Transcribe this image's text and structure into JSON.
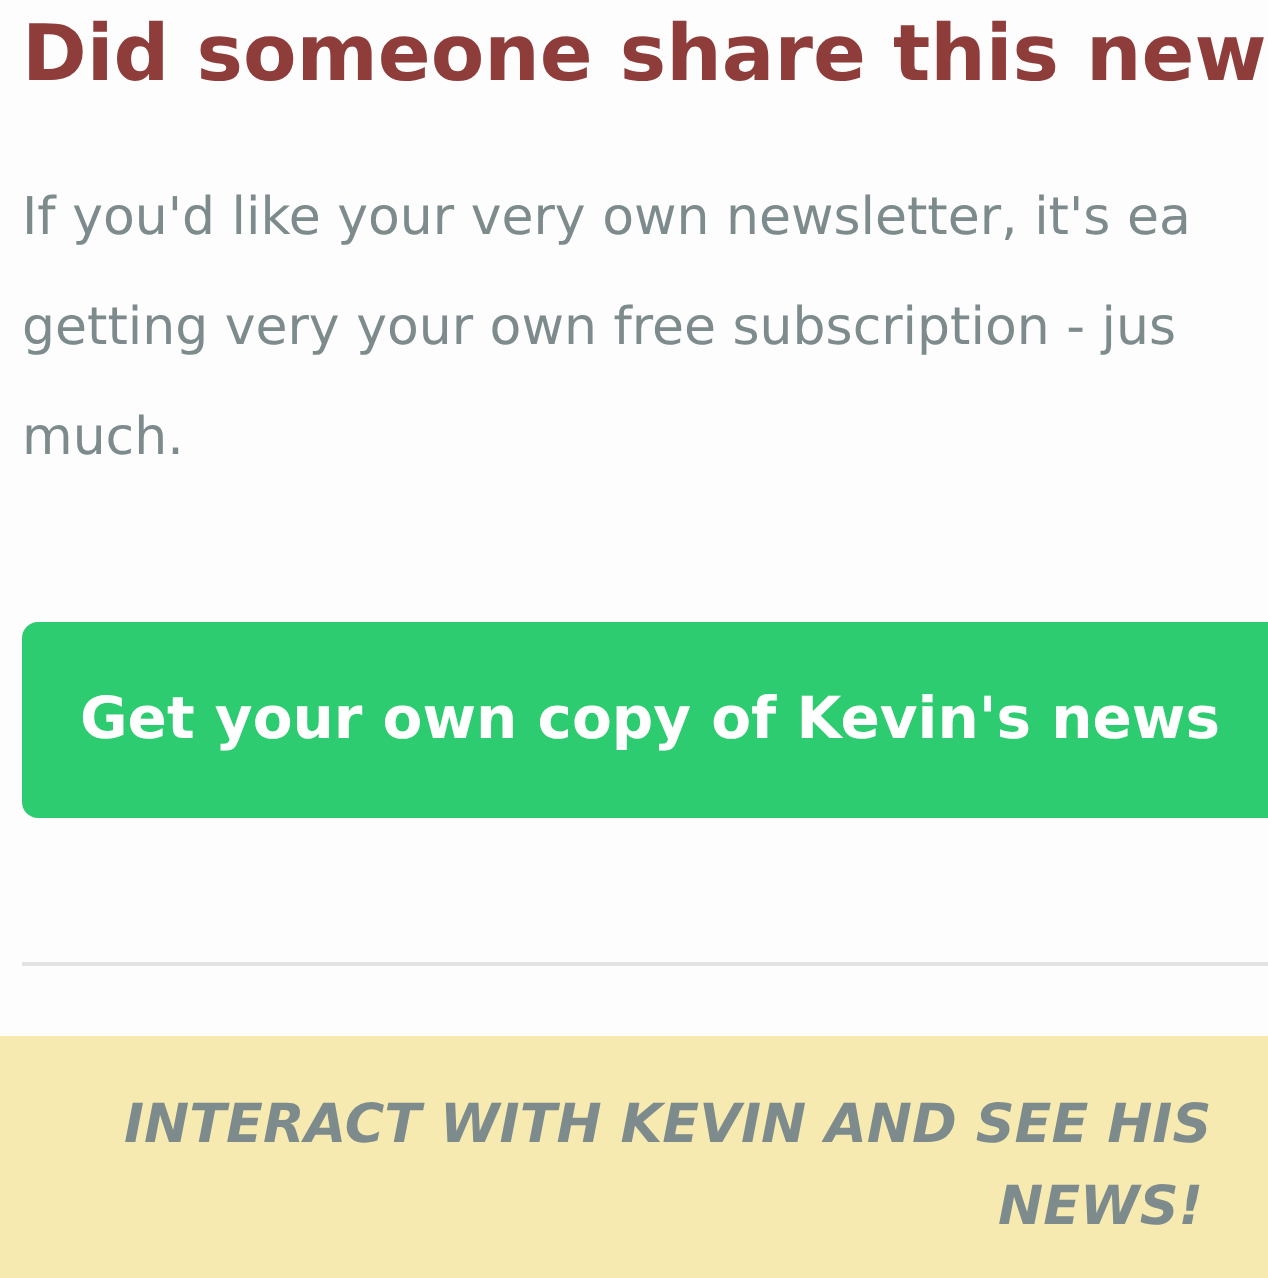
{
  "heading": "Did someone share this new",
  "intro_lines": [
    "If you'd like your very own newsletter, it's ea",
    "getting very your own free subscription - jus",
    "much."
  ],
  "cta_button": "Get your own copy of Kevin's news",
  "banner_lines": [
    "INTERACT WITH KEVIN AND SEE HIS",
    "NEWS!"
  ]
}
